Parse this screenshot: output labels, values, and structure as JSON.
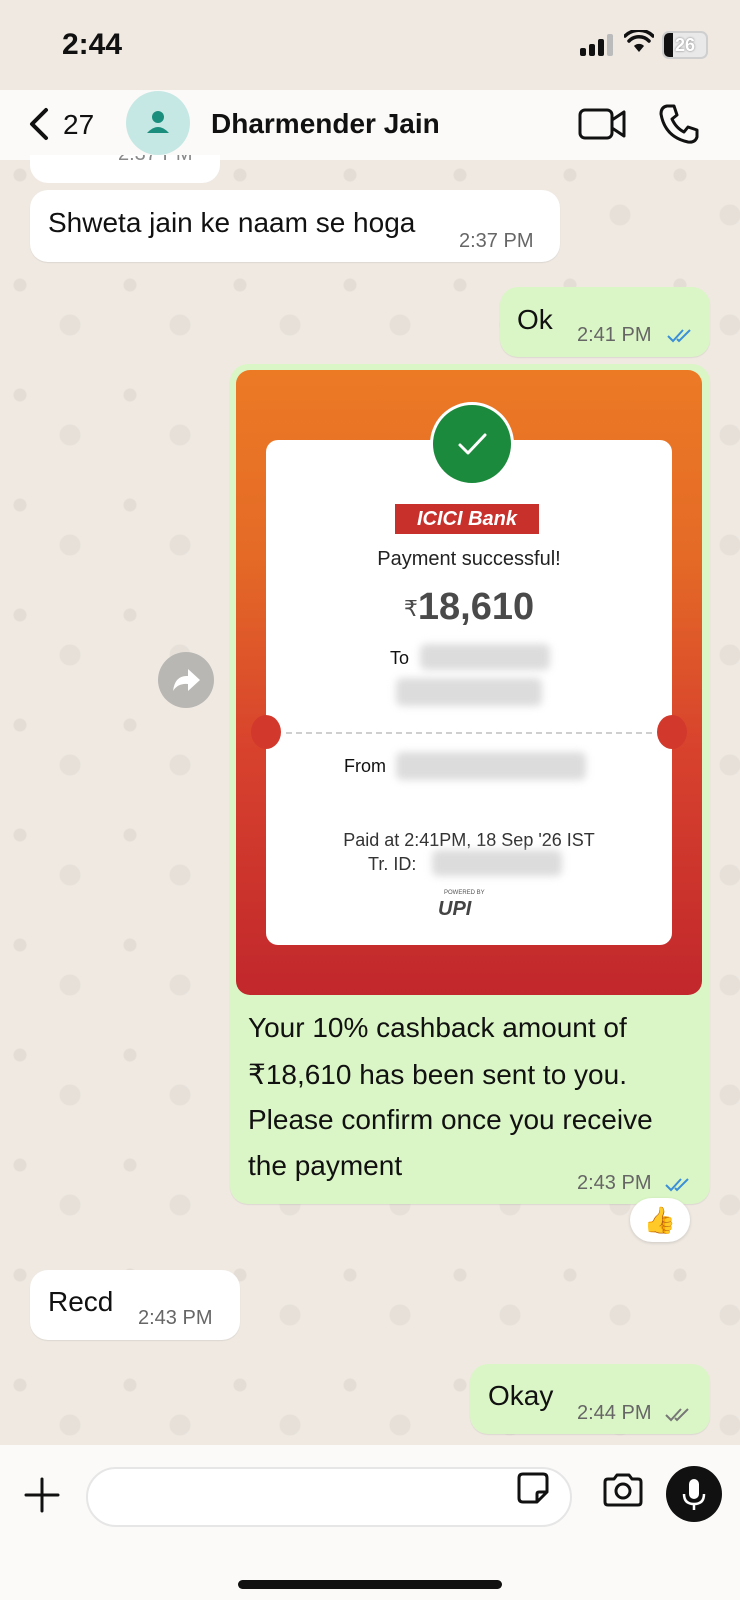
{
  "status_bar": {
    "time": "2:44",
    "battery": "26"
  },
  "header": {
    "back_count": "27",
    "contact_name": "Dharmender Jain"
  },
  "messages": {
    "cut_time": "2:37 PM",
    "m1": {
      "text": "Shweta jain ke naam se hoga",
      "time": "2:37 PM"
    },
    "m2": {
      "text": "Ok",
      "time": "2:41 PM"
    },
    "m3": {
      "caption_line1": "Your 10% cashback amount of",
      "caption_line2": "₹18,610 has been sent to you.",
      "caption_line3": "Please confirm once you receive",
      "caption_line4": "the payment",
      "time": "2:43 PM",
      "reaction": "👍"
    },
    "m4": {
      "text": "Recd",
      "time": "2:43 PM"
    },
    "m5": {
      "text": "Okay",
      "time": "2:44 PM"
    }
  },
  "receipt": {
    "bank": "ICICI Bank",
    "status": "Payment successful!",
    "currency": "₹",
    "amount": "18,610",
    "to_label": "To",
    "from_label": "From",
    "paid_at": "Paid at 2:41PM, 18 Sep '26 IST",
    "tr_label": "Tr. ID:",
    "powered_by": "POWERED BY",
    "upi": "UPI"
  },
  "composer": {
    "placeholder": ""
  },
  "colors": {
    "outgoing": "#dbf6c6",
    "incoming": "#ffffff",
    "read_tick": "#3b8fd9",
    "accent": "#1b8a3c"
  },
  "icons": [
    "back-chevron-icon",
    "person-icon",
    "video-icon",
    "phone-icon",
    "check-icon",
    "forward-icon",
    "plus-icon",
    "sticker-icon",
    "camera-icon",
    "mic-icon"
  ]
}
